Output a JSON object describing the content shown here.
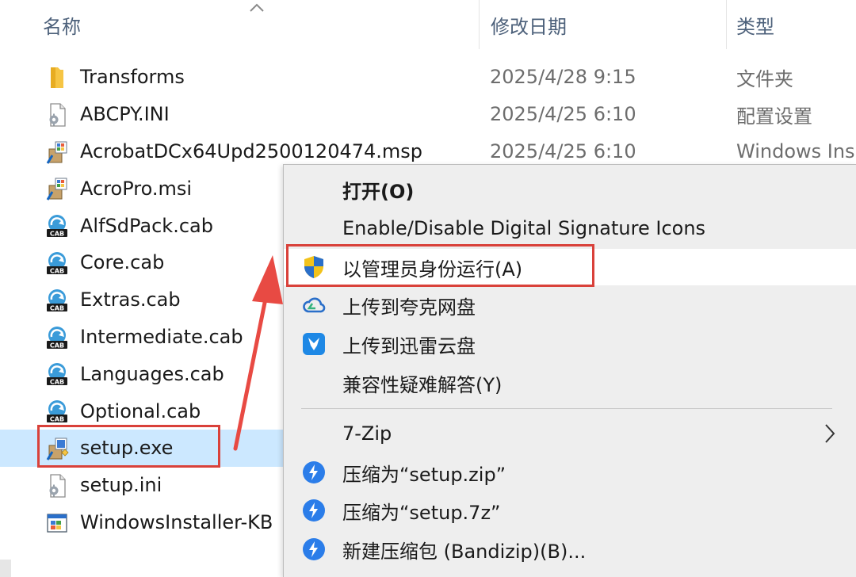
{
  "header": {
    "name": "名称",
    "date": "修改日期",
    "type": "类型"
  },
  "files": [
    {
      "icon": "folder-icon",
      "name": "Transforms",
      "date": "2025/4/28 9:15",
      "type": "文件夹"
    },
    {
      "icon": "ini-file-icon",
      "name": "ABCPY.INI",
      "date": "2025/4/25 6:10",
      "type": "配置设置"
    },
    {
      "icon": "installer-package-icon",
      "name": "AcrobatDCx64Upd2500120474.msp",
      "date": "2025/4/25 6:10",
      "type": "Windows Ins"
    },
    {
      "icon": "installer-package-icon",
      "name": "AcroPro.msi",
      "date": "",
      "type": ""
    },
    {
      "icon": "cab-file-icon",
      "name": "AlfSdPack.cab",
      "date": "",
      "type": ""
    },
    {
      "icon": "cab-file-icon",
      "name": "Core.cab",
      "date": "",
      "type": ""
    },
    {
      "icon": "cab-file-icon",
      "name": "Extras.cab",
      "date": "",
      "type": ""
    },
    {
      "icon": "cab-file-icon",
      "name": "Intermediate.cab",
      "date": "",
      "type": ""
    },
    {
      "icon": "cab-file-icon",
      "name": "Languages.cab",
      "date": "",
      "type": ""
    },
    {
      "icon": "cab-file-icon",
      "name": "Optional.cab",
      "date": "",
      "type": ""
    },
    {
      "icon": "setup-exe-icon",
      "name": "setup.exe",
      "date": "",
      "type": "",
      "selected": true
    },
    {
      "icon": "ini-file-icon",
      "name": "setup.ini",
      "date": "",
      "type": ""
    },
    {
      "icon": "windows-installer-icon",
      "name": "WindowsInstaller-KB",
      "date": "",
      "type": ""
    }
  ],
  "context_menu": {
    "items": [
      {
        "label": "打开(O)",
        "bold": true
      },
      {
        "label": "Enable/Disable Digital Signature Icons"
      },
      {
        "label": "以管理员身份运行(A)",
        "icon": "uac-shield-icon",
        "hover": true
      },
      {
        "label": "上传到夸克网盘",
        "icon": "quark-cloud-icon"
      },
      {
        "label": "上传到迅雷云盘",
        "icon": "xunlei-cloud-icon"
      },
      {
        "label": "兼容性疑难解答(Y)"
      },
      {
        "label": "7-Zip",
        "submenu": true
      },
      {
        "label": "压缩为“setup.zip”",
        "icon": "bandizip-icon"
      },
      {
        "label": "压缩为“setup.7z”",
        "icon": "bandizip-icon"
      },
      {
        "label": "新建压缩包 (Bandizip)(B)...",
        "icon": "bandizip-icon"
      }
    ]
  },
  "colors": {
    "highlight_box": "#d9413a",
    "selection": "#cce8ff",
    "menu_bg": "#eeeeee"
  }
}
